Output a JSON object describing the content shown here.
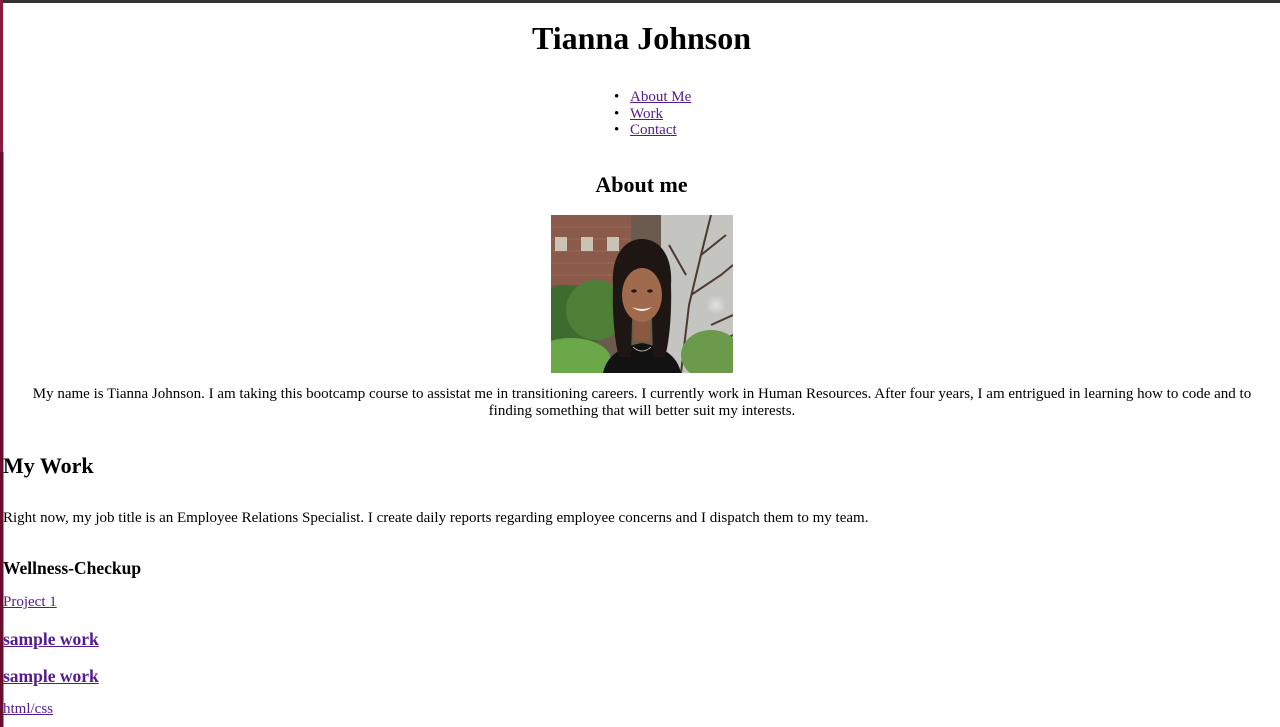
{
  "header": {
    "title": "Tianna Johnson"
  },
  "nav": {
    "items": [
      {
        "label": "About Me"
      },
      {
        "label": "Work"
      },
      {
        "label": "Contact"
      }
    ]
  },
  "about": {
    "heading": "About me",
    "photo_alt": "portrait photo",
    "text": "My name is Tianna Johnson. I am taking this bootcamp course to assistat me in transitioning careers. I currently work in Human Resources. After four years, I am entrigued in learning how to code and to finding something that will better suit my interests."
  },
  "work": {
    "heading": "My Work",
    "text": "Right now, my job title is an Employee Relations Specialist. I create daily reports regarding employee concerns and I dispatch them to my team.",
    "project_heading": "Wellness-Checkup",
    "project_link": "Project 1",
    "sample_links": [
      "sample work",
      "sample work"
    ],
    "tech_link": "html/css"
  },
  "colors": {
    "link_visited": "#551a8b",
    "frame_accent": "#8b1a3f",
    "frame_dark": "#6b0d2e"
  }
}
